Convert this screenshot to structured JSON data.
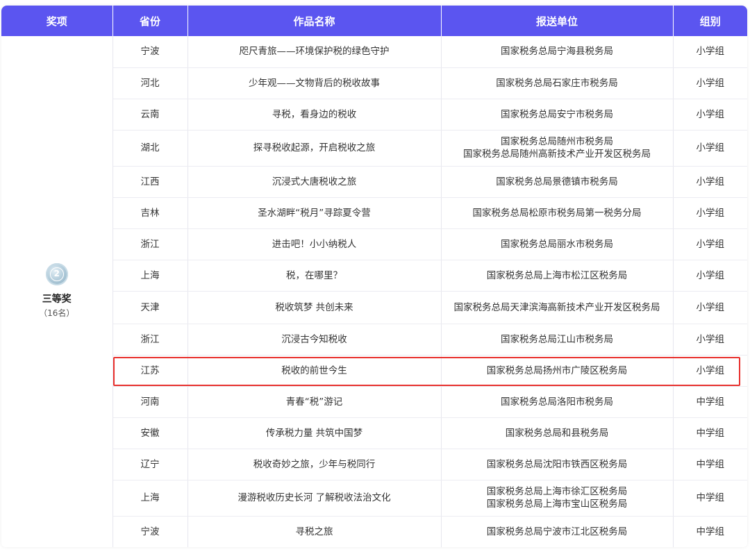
{
  "headers": [
    "奖项",
    "省份",
    "作品名称",
    "报送单位",
    "组别"
  ],
  "award": {
    "medal_number": "2",
    "name": "三等奖",
    "count": "（16名）"
  },
  "rows": [
    {
      "province": "宁波",
      "title": "咫尺青旅——环境保护税的绿色守护",
      "unit": "国家税务总局宁海县税务局",
      "group": "小学组"
    },
    {
      "province": "河北",
      "title": "少年观——文物背后的税收故事",
      "unit": "国家税务总局石家庄市税务局",
      "group": "小学组"
    },
    {
      "province": "云南",
      "title": "寻税，看身边的税收",
      "unit": "国家税务总局安宁市税务局",
      "group": "小学组"
    },
    {
      "province": "湖北",
      "title": "探寻税收起源，开启税收之旅",
      "unit": "国家税务总局随州市税务局\n国家税务总局随州高新技术产业开发区税务局",
      "group": "小学组"
    },
    {
      "province": "江西",
      "title": "沉浸式大唐税收之旅",
      "unit": "国家税务总局景德镇市税务局",
      "group": "小学组"
    },
    {
      "province": "吉林",
      "title": "圣水湖畔“税月”寻踪夏令营",
      "unit": "国家税务总局松原市税务局第一税务分局",
      "group": "小学组"
    },
    {
      "province": "浙江",
      "title": "进击吧！小小纳税人",
      "unit": "国家税务总局丽水市税务局",
      "group": "小学组"
    },
    {
      "province": "上海",
      "title": "税，在哪里？",
      "unit": "国家税务总局上海市松江区税务局",
      "group": "小学组"
    },
    {
      "province": "天津",
      "title": "税收筑梦 共创未来",
      "unit": "国家税务总局天津滨海高新技术产业开发区税务局",
      "group": "小学组"
    },
    {
      "province": "浙江",
      "title": "沉浸古今知税收",
      "unit": "国家税务总局江山市税务局",
      "group": "小学组"
    },
    {
      "province": "江苏",
      "title": "税收的前世今生",
      "unit": "国家税务总局扬州市广陵区税务局",
      "group": "小学组"
    },
    {
      "province": "河南",
      "title": "青春“税”游记",
      "unit": "国家税务总局洛阳市税务局",
      "group": "中学组"
    },
    {
      "province": "安徽",
      "title": "传承税力量 共筑中国梦",
      "unit": "国家税务总局和县税务局",
      "group": "中学组"
    },
    {
      "province": "辽宁",
      "title": "税收奇妙之旅，少年与税同行",
      "unit": "国家税务总局沈阳市铁西区税务局",
      "group": "中学组"
    },
    {
      "province": "上海",
      "title": "漫游税收历史长河 了解税收法治文化",
      "unit": "国家税务总局上海市徐汇区税务局\n国家税务总局上海市宝山区税务局",
      "group": "中学组"
    },
    {
      "province": "宁波",
      "title": "寻税之旅",
      "unit": "国家税务总局宁波市江北区税务局",
      "group": "中学组"
    }
  ],
  "colors": {
    "header_bg": "#5b55f0",
    "highlight_border": "#e8302c"
  }
}
